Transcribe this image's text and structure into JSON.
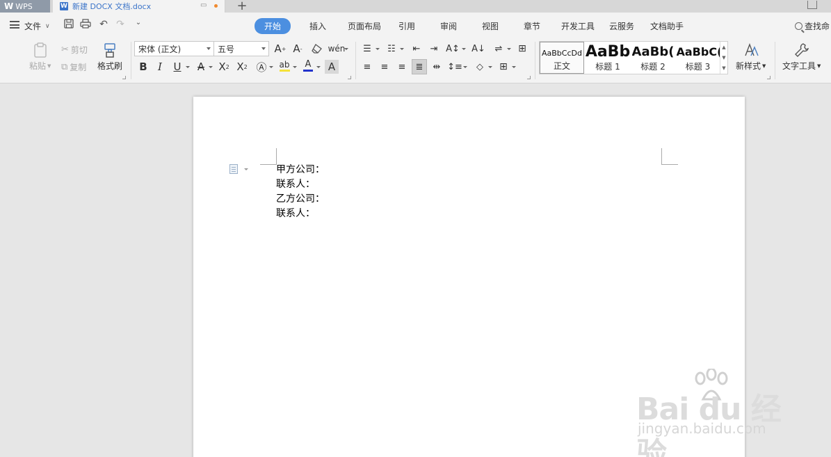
{
  "titlebar": {
    "app_name": "WPS",
    "doc_tab_title": "新建 DOCX 文档.docx",
    "new_tab_label": "+"
  },
  "menu": {
    "file_label": "文件",
    "tabs": [
      "开始",
      "插入",
      "页面布局",
      "引用",
      "审阅",
      "视图",
      "章节",
      "开发工具",
      "云服务",
      "文档助手"
    ],
    "active_tab": "开始",
    "search_label": "查找命"
  },
  "ribbon": {
    "paste_label": "粘贴",
    "cut_label": "剪切",
    "copy_label": "复制",
    "format_painter_label": "格式刷",
    "font_name": "宋体 (正文)",
    "font_size": "五号",
    "styles": [
      {
        "sample": "AaBbCcDd",
        "label": "正文"
      },
      {
        "sample": "AaBb",
        "label": "标题 1"
      },
      {
        "sample": "AaBb(",
        "label": "标题 2"
      },
      {
        "sample": "AaBbC(",
        "label": "标题 3"
      }
    ],
    "new_style_label": "新样式",
    "text_tools_label": "文字工具"
  },
  "document": {
    "lines": [
      "甲方公司：",
      "联系人：",
      "乙方公司：",
      "联系人："
    ]
  },
  "watermark": {
    "main": "Bai du 经验",
    "sub": "jingyan.baidu.com"
  },
  "colors": {
    "accent": "#4c8fe0",
    "doc_tab_text": "#3b74c9",
    "wps_tab_bg": "#8f9aa8",
    "unsaved_dot": "#f08a2f",
    "font_color_bar": "#2233cc",
    "highlight_bar": "#f5e23a"
  }
}
